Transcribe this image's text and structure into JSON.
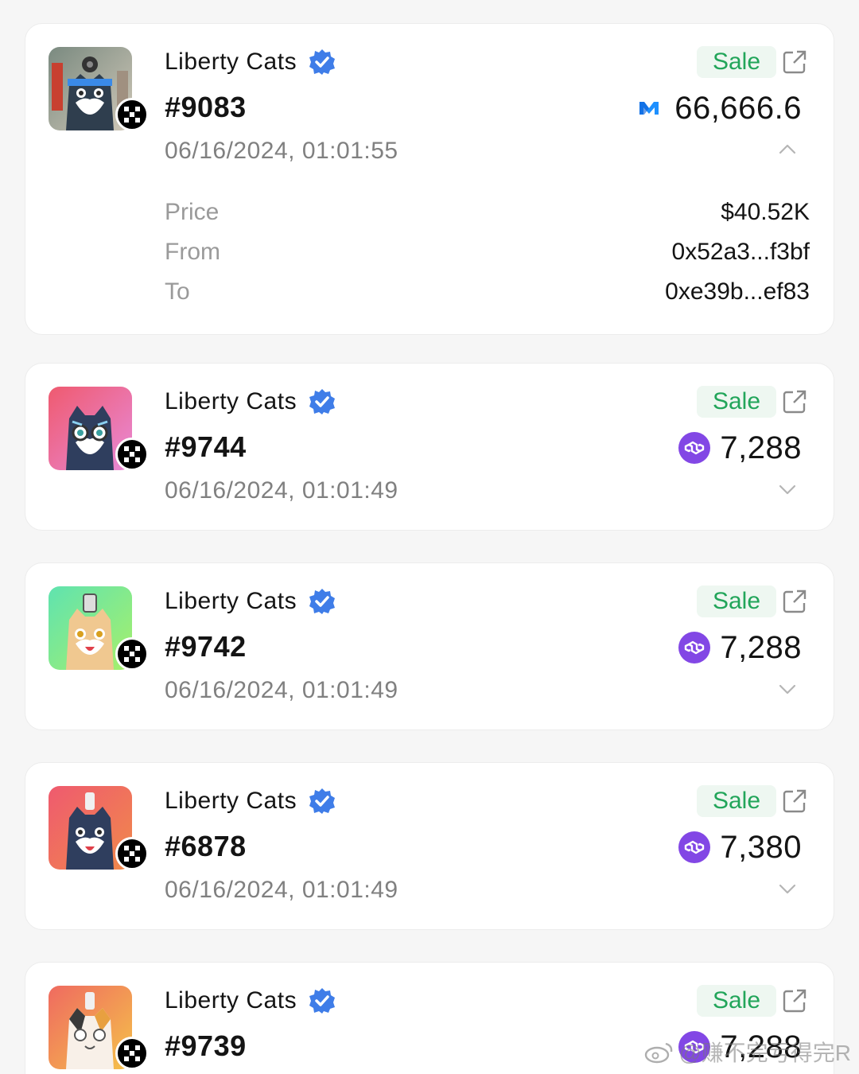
{
  "items": [
    {
      "collection": "Liberty Cats",
      "token_id": "#9083",
      "timestamp": "06/16/2024, 01:01:55",
      "badge": "Sale",
      "amount": "66,666.6",
      "token_icon": "mantle-icon",
      "expanded": true,
      "details": [
        {
          "label": "Price",
          "value": "$40.52K"
        },
        {
          "label": "From",
          "value": "0x52a3...f3bf"
        },
        {
          "label": "To",
          "value": "0xe39b...ef83"
        }
      ],
      "bg": [
        "#7a8a80",
        "#d0c8b8"
      ]
    },
    {
      "collection": "Liberty Cats",
      "token_id": "#9744",
      "timestamp": "06/16/2024, 01:01:49",
      "badge": "Sale",
      "amount": "7,288",
      "token_icon": "polygon-icon",
      "expanded": false,
      "bg": [
        "#ef5a6f",
        "#e88ad8"
      ]
    },
    {
      "collection": "Liberty Cats",
      "token_id": "#9742",
      "timestamp": "06/16/2024, 01:01:49",
      "badge": "Sale",
      "amount": "7,288",
      "token_icon": "polygon-icon",
      "expanded": false,
      "bg": [
        "#5fe3b0",
        "#a8f06a"
      ]
    },
    {
      "collection": "Liberty Cats",
      "token_id": "#6878",
      "timestamp": "06/16/2024, 01:01:49",
      "badge": "Sale",
      "amount": "7,380",
      "token_icon": "polygon-icon",
      "expanded": false,
      "bg": [
        "#ef5a6f",
        "#f08a4a"
      ]
    },
    {
      "collection": "Liberty Cats",
      "token_id": "#9739",
      "timestamp": "",
      "badge": "Sale",
      "amount": "7,288",
      "token_icon": "polygon-icon",
      "expanded": false,
      "bg": [
        "#ef6a60",
        "#f5c24a"
      ]
    }
  ],
  "watermark": "@赚不完亏得完R",
  "colors": {
    "sale_text": "#22a55a",
    "sale_bg": "#eef7f1",
    "verified": "#3f7de8",
    "polygon": "#8247e5",
    "mantle": "#1e90ff"
  }
}
